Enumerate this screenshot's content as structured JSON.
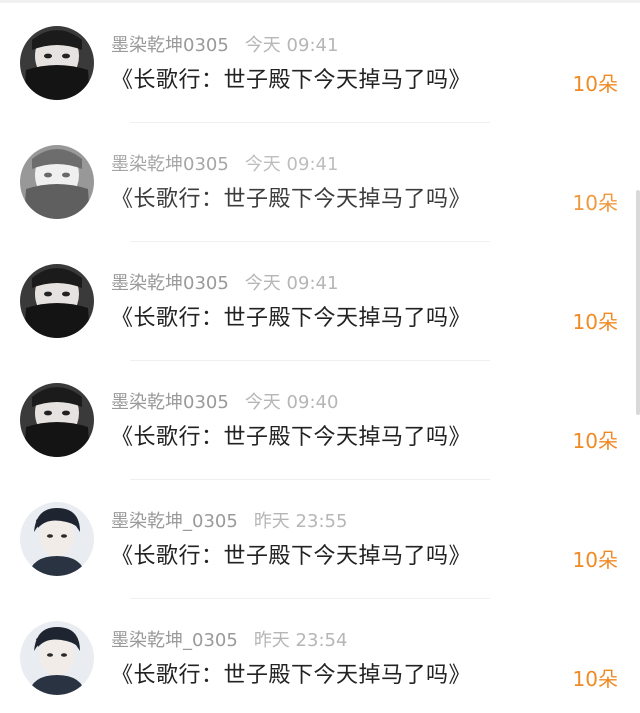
{
  "feed": {
    "rows": [
      {
        "user": "墨染乾坤0305",
        "time": "今天 09:41",
        "title": "《长歌行：世子殿下今天掉马了吗》",
        "amount": "10朵",
        "avatar": "masked-man-avatar"
      },
      {
        "user": "墨染乾坤0305",
        "time": "今天 09:41",
        "title": "《长歌行：世子殿下今天掉马了吗》",
        "amount": "10朵",
        "avatar": "masked-man-avatar"
      },
      {
        "user": "墨染乾坤0305",
        "time": "今天 09:41",
        "title": "《长歌行：世子殿下今天掉马了吗》",
        "amount": "10朵",
        "avatar": "masked-man-avatar"
      },
      {
        "user": "墨染乾坤0305",
        "time": "今天 09:40",
        "title": "《长歌行：世子殿下今天掉马了吗》",
        "amount": "10朵",
        "avatar": "masked-man-avatar"
      },
      {
        "user": "墨染乾坤_0305",
        "time": "昨天 23:55",
        "title": "《长歌行：世子殿下今天掉马了吗》",
        "amount": "10朵",
        "avatar": "young-man-avatar"
      },
      {
        "user": "墨染乾坤_0305",
        "time": "昨天 23:54",
        "title": "《长歌行：世子殿下今天掉马了吗》",
        "amount": "10朵",
        "avatar": "young-man-avatar"
      }
    ]
  },
  "colors": {
    "amount": "#f08a24",
    "meta": "#9a9a9a",
    "title": "#222222"
  }
}
